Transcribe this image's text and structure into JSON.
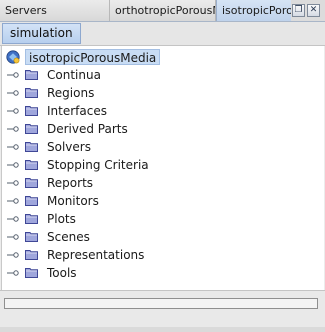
{
  "tabs": [
    {
      "label": "Servers",
      "active": false
    },
    {
      "label": "orthotropicPorousMedia",
      "active": false
    },
    {
      "label": "isotropicPorousMedia",
      "active": true
    }
  ],
  "tab_controls": {
    "close_glyph": "×",
    "restore_glyph": "❐",
    "window_close_glyph": "✕"
  },
  "subbar": {
    "simulation_label": "simulation"
  },
  "tree": {
    "root": {
      "label": "isotropicPorousMedia",
      "icon": "simulation-root-icon",
      "selected": true
    },
    "items": [
      {
        "label": "Continua",
        "icon": "folder-icon"
      },
      {
        "label": "Regions",
        "icon": "folder-icon"
      },
      {
        "label": "Interfaces",
        "icon": "folder-icon"
      },
      {
        "label": "Derived Parts",
        "icon": "folder-icon"
      },
      {
        "label": "Solvers",
        "icon": "folder-icon"
      },
      {
        "label": "Stopping Criteria",
        "icon": "folder-icon"
      },
      {
        "label": "Reports",
        "icon": "folder-icon"
      },
      {
        "label": "Monitors",
        "icon": "folder-icon"
      },
      {
        "label": "Plots",
        "icon": "folder-icon"
      },
      {
        "label": "Scenes",
        "icon": "folder-icon"
      },
      {
        "label": "Representations",
        "icon": "folder-icon"
      },
      {
        "label": "Tools",
        "icon": "folder-icon"
      }
    ]
  },
  "colors": {
    "selection": "#c8dcf4",
    "active_tab": "#bfd3ec",
    "folder_fill": "#9fa6dc",
    "folder_stroke": "#3f4796"
  }
}
